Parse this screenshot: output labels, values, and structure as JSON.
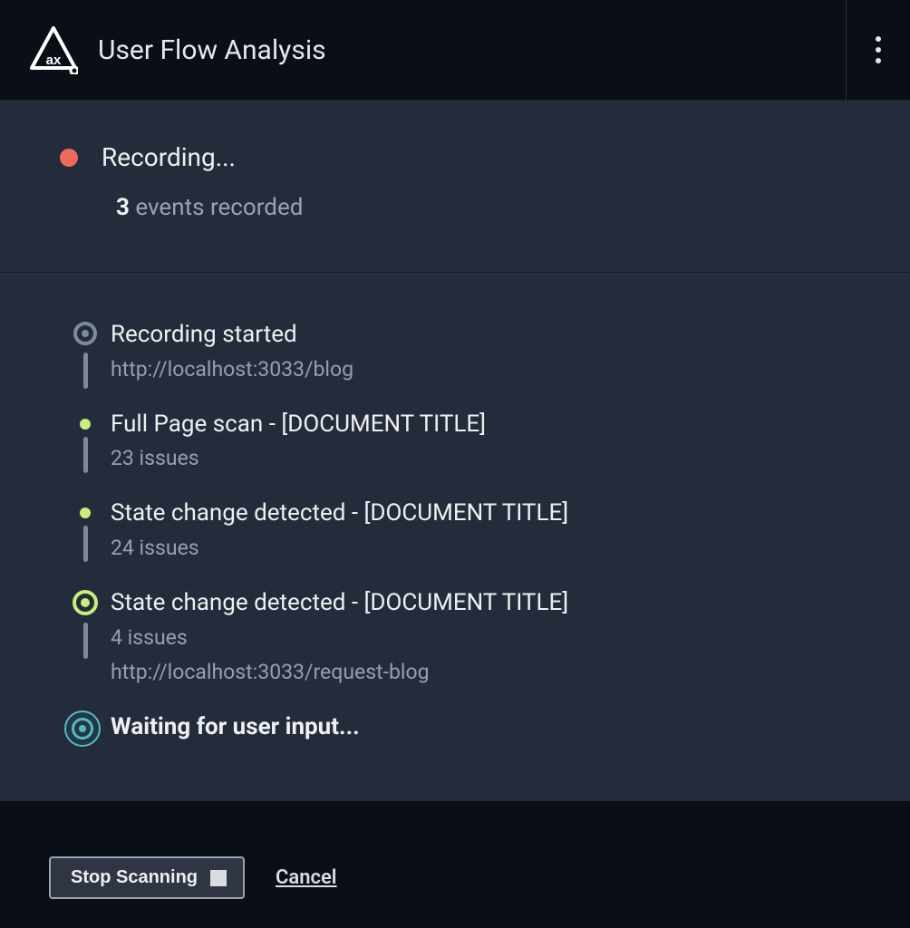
{
  "header": {
    "title": "User Flow Analysis",
    "logo_alt": "axe-logo"
  },
  "status": {
    "label": "Recording...",
    "count": "3",
    "count_suffix": "events recorded"
  },
  "timeline": [
    {
      "marker": "ring-gray",
      "title": "Recording started",
      "subs": [
        "http://localhost:3033/blog"
      ],
      "connector": true
    },
    {
      "marker": "small-green",
      "title": "Full Page scan - [DOCUMENT TITLE]",
      "subs": [
        "23 issues"
      ],
      "connector": true
    },
    {
      "marker": "small-green",
      "title": "State change detected - [DOCUMENT TITLE]",
      "subs": [
        "24 issues"
      ],
      "connector": true
    },
    {
      "marker": "ring-green",
      "title": "State change detected - [DOCUMENT TITLE]",
      "subs": [
        "4 issues",
        "http://localhost:3033/request-blog"
      ],
      "connector": true
    },
    {
      "marker": "accent",
      "title": "Waiting for user input...",
      "title_bold": true,
      "subs": [],
      "connector": false
    }
  ],
  "footer": {
    "stop_label": "Stop Scanning",
    "cancel_label": "Cancel"
  }
}
